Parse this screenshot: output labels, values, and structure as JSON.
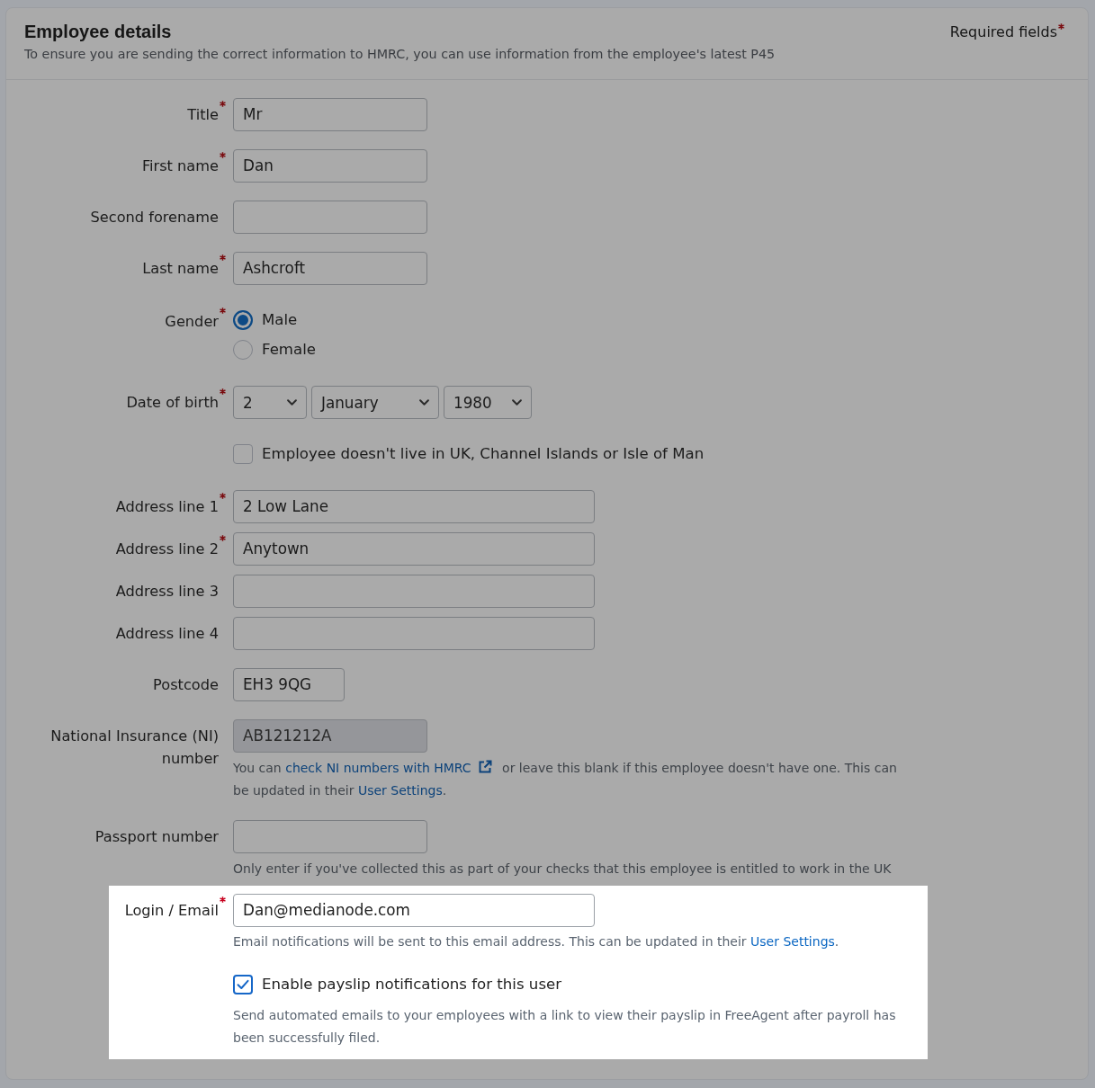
{
  "page": {
    "title": "Employee details",
    "subtitle": "To ensure you are sending the correct information to HMRC, you can use information from the employee's latest P45",
    "required_legend": "Required fields"
  },
  "sections": [
    {
      "highlighted": false,
      "fields": [
        {
          "kind": "text",
          "label": "Title",
          "required": true,
          "disabled": false,
          "value": "Mr"
        },
        {
          "kind": "text",
          "label": "First name",
          "required": true,
          "disabled": false,
          "value": "Dan"
        },
        {
          "kind": "text",
          "label": "Second forename",
          "required": false,
          "disabled": false
        },
        {
          "kind": "text",
          "label": "Last name",
          "required": true,
          "disabled": false,
          "value": "Ashcroft"
        },
        {
          "kind": "radio",
          "label": "Gender",
          "required": true,
          "options": [
            {
              "label": "Male",
              "selected": true
            },
            {
              "label": "Female",
              "selected": false
            }
          ]
        },
        {
          "kind": "select",
          "label": "Date of birth",
          "required": true,
          "selects": [
            {
              "value": "2"
            },
            {
              "value": "January"
            },
            {
              "value": "1980"
            }
          ]
        },
        {
          "kind": "checkbox",
          "label": "Employee doesn't live in UK, Channel Islands or Isle of Man",
          "checked": false
        },
        {
          "kind": "address",
          "label": "Address line 1",
          "required": true,
          "disabled": false,
          "value": "2 Low Lane"
        },
        {
          "kind": "address",
          "label": "Address line 2",
          "required": true,
          "disabled": false,
          "value": "Anytown"
        },
        {
          "kind": "address",
          "label": "Address line 3",
          "required": false,
          "disabled": false
        },
        {
          "kind": "address",
          "label": "Address line 4",
          "required": false,
          "disabled": false
        },
        {
          "kind": "short_text",
          "label": "Postcode",
          "required": false,
          "disabled": false,
          "value": "EH3 9QG"
        },
        {
          "kind": "text",
          "label": "National Insurance (NI) number",
          "required": false,
          "disabled": true,
          "value": "AB121212A",
          "help": [
            {
              "kind": "text",
              "text": "You can "
            },
            {
              "kind": "external_link",
              "text": "check NI numbers with HMRC"
            },
            {
              "kind": "text",
              "text": " or leave this blank if this employee doesn't have one. This can be updated in their "
            },
            {
              "kind": "link",
              "text": "User Settings"
            },
            {
              "kind": "text",
              "text": "."
            }
          ]
        },
        {
          "kind": "text",
          "label": "Passport number",
          "required": false,
          "disabled": false,
          "help": [
            {
              "kind": "text",
              "text": "Only enter if you've collected this as part of your checks that this employee is entitled to work in the UK"
            }
          ]
        }
      ]
    },
    {
      "highlighted": true,
      "fields": [
        {
          "kind": "wide_text",
          "label": "Login / Email",
          "required": true,
          "disabled": false,
          "value": "Dan@medianode.com",
          "help": [
            {
              "kind": "text",
              "text": "Email notifications will be sent to this email address. This can be updated in their "
            },
            {
              "kind": "link",
              "text": "User Settings"
            },
            {
              "kind": "text",
              "text": "."
            }
          ]
        },
        {
          "kind": "checkbox",
          "label": "Enable payslip notifications for this user",
          "checked": true,
          "help": [
            {
              "kind": "text",
              "text": "Send automated emails to your employees with a link to view their payslip in FreeAgent after payroll has been successfully filed."
            }
          ]
        }
      ]
    }
  ]
}
